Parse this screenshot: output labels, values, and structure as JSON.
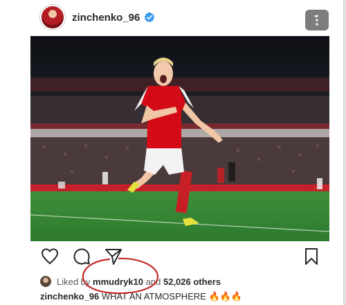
{
  "post": {
    "username": "zinchenko_96",
    "liked_by_prefix": "Liked by",
    "liked_by_user": "mmudryk10",
    "liked_by_conjunction": "and",
    "others_count": "52,026 others",
    "caption_user": "zinchenko_96",
    "caption_text": "WHAT AN ATMOSPHERE 🔥🔥🔥"
  },
  "icons": {
    "verified": "verified-badge-icon",
    "more": "more-options-icon",
    "like": "heart-icon",
    "comment": "comment-icon",
    "share": "send-icon",
    "save": "bookmark-icon"
  },
  "colors": {
    "verified_blue": "#3897f0",
    "annotation_red": "#c62828",
    "kit_red": "#db0007",
    "pitch_green": "#3f9a3a"
  }
}
